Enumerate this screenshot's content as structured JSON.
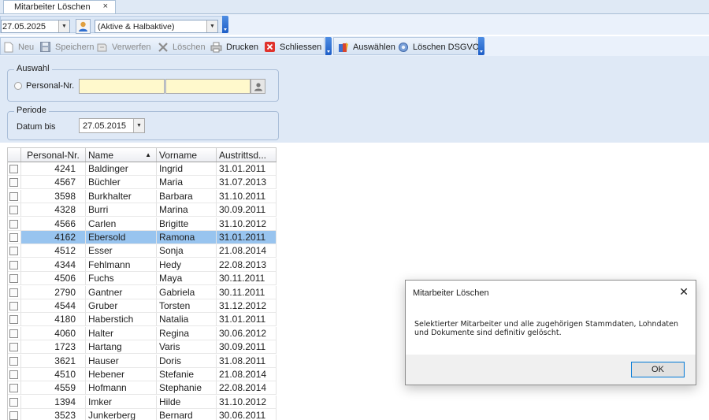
{
  "tab": {
    "label": "Mitarbeiter Löschen",
    "close": "×"
  },
  "selector": {
    "date": "27.05.2025",
    "status": "(Aktive & Halbaktive)"
  },
  "toolbar": {
    "new": "Neu",
    "save": "Speichern",
    "discard": "Verwerfen",
    "delete": "Löschen",
    "print": "Drucken",
    "close": "Schliessen",
    "select": "Auswählen",
    "delete_dsgvo": "Löschen DSGVO"
  },
  "filter": {
    "selection_legend": "Auswahl",
    "personal_label": "Personal-Nr.",
    "period_legend": "Periode",
    "date_label": "Datum bis",
    "date_value": "27.05.2015"
  },
  "grid": {
    "headers": [
      "Personal-Nr.",
      "Name",
      "Vorname",
      "Austrittsd..."
    ],
    "sort_indicator": "▲",
    "rows": [
      {
        "nr": "4241",
        "name": "Baldinger",
        "vorname": "Ingrid",
        "datum": "31.01.2011"
      },
      {
        "nr": "4567",
        "name": "Büchler",
        "vorname": "Maria",
        "datum": "31.07.2013"
      },
      {
        "nr": "3598",
        "name": "Burkhalter",
        "vorname": "Barbara",
        "datum": "31.10.2011"
      },
      {
        "nr": "4328",
        "name": "Burri",
        "vorname": "Marina",
        "datum": "30.09.2011"
      },
      {
        "nr": "4566",
        "name": "Carlen",
        "vorname": "Brigitte",
        "datum": "31.10.2012"
      },
      {
        "nr": "4162",
        "name": "Ebersold",
        "vorname": "Ramona",
        "datum": "31.01.2011",
        "selected": true
      },
      {
        "nr": "4512",
        "name": "Esser",
        "vorname": "Sonja",
        "datum": "21.08.2014"
      },
      {
        "nr": "4344",
        "name": "Fehlmann",
        "vorname": "Hedy",
        "datum": "22.08.2013"
      },
      {
        "nr": "4506",
        "name": "Fuchs",
        "vorname": "Maya",
        "datum": "30.11.2011"
      },
      {
        "nr": "2790",
        "name": "Gantner",
        "vorname": "Gabriela",
        "datum": "30.11.2011"
      },
      {
        "nr": "4544",
        "name": "Gruber",
        "vorname": "Torsten",
        "datum": "31.12.2012"
      },
      {
        "nr": "4180",
        "name": "Haberstich",
        "vorname": "Natalia",
        "datum": "31.01.2011"
      },
      {
        "nr": "4060",
        "name": "Halter",
        "vorname": "Regina",
        "datum": "30.06.2012"
      },
      {
        "nr": "1723",
        "name": "Hartang",
        "vorname": "Varis",
        "datum": "30.09.2011"
      },
      {
        "nr": "3621",
        "name": "Hauser",
        "vorname": "Doris",
        "datum": "31.08.2011"
      },
      {
        "nr": "4510",
        "name": "Hebener",
        "vorname": "Stefanie",
        "datum": "21.08.2014"
      },
      {
        "nr": "4559",
        "name": "Hofmann",
        "vorname": "Stephanie",
        "datum": "22.08.2014"
      },
      {
        "nr": "1394",
        "name": "Imker",
        "vorname": "Hilde",
        "datum": "31.10.2012"
      },
      {
        "nr": "3523",
        "name": "Junkerberg",
        "vorname": "Bernard",
        "datum": "30.06.2011"
      }
    ]
  },
  "dialog": {
    "title": "Mitarbeiter Löschen",
    "close": "✕",
    "message_line1": "Selektierter Mitarbeiter und alle zugehörigen Stammdaten, Lohndaten",
    "message_line2": "und Dokumente sind definitiv gelöscht.",
    "ok": "OK"
  },
  "colors": {
    "selection": "#98c4ef",
    "panel": "#dfe9f6",
    "input_highlight": "#fff9cc",
    "accent_blue": "#1e5ec7"
  }
}
